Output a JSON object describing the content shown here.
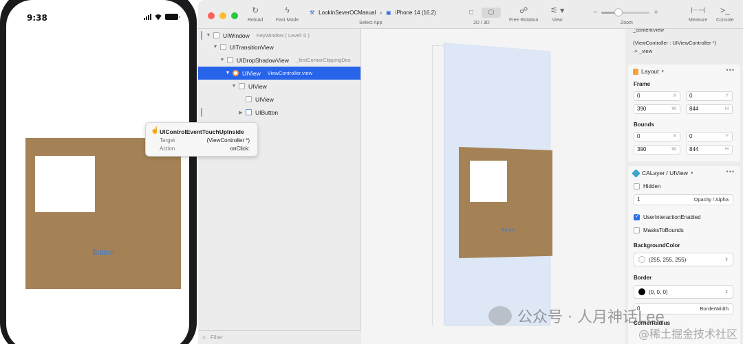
{
  "simulator": {
    "time": "9:38",
    "button_label": "Button"
  },
  "toolbar": {
    "reload": "Reload",
    "fast_mode": "Fast Mode",
    "app_name": "LookInSeverOCManual",
    "device": "iPhone 14 (16.2)",
    "select_app": "Select App",
    "mode_label": "2D / 3D",
    "free_rotation": "Free Rotation",
    "view": "View",
    "zoom": "Zoom",
    "zoom_level": 0.35,
    "measure": "Measure",
    "console": "Console"
  },
  "tree": {
    "rows": [
      {
        "name": "UIWindow",
        "sub": "KeyWindow ( Level: 0 )"
      },
      {
        "name": "UITransitionView",
        "sub": ""
      },
      {
        "name": "UIDropShadowView",
        "sub": "_firstCornerClippingDes"
      },
      {
        "name": "UIView",
        "sub": "ViewController.view"
      },
      {
        "name": "UIView",
        "sub": ""
      },
      {
        "name": "UIView",
        "sub": ""
      },
      {
        "name": "UIButton",
        "sub": ""
      }
    ],
    "filter_placeholder": "Filter"
  },
  "tooltip": {
    "title": "UIControlEventTouchUpInside",
    "target_key": "Target",
    "target_value": "(ViewController *)",
    "action_key": "Action",
    "action_value": "onClick:"
  },
  "canvas": {
    "button_label": "Button"
  },
  "inspector": {
    "top_lines": [
      "_contentView",
      "(ViewController : UIViewController *)",
      "-> _view"
    ],
    "layout_title": "Layout",
    "frame_label": "Frame",
    "frame": {
      "x": "0",
      "y": "0",
      "w": "390",
      "h": "844"
    },
    "bounds_label": "Bounds",
    "bounds": {
      "x": "0",
      "y": "0",
      "w": "390",
      "h": "844"
    },
    "unit_x": "X",
    "unit_y": "Y",
    "unit_w": "W",
    "unit_h": "H",
    "calayer_title": "CALayer / UIView",
    "hidden": "Hidden",
    "opacity_value": "1",
    "opacity_label": "Opacity / Alpha",
    "user_interaction": "UserInteractionEnabled",
    "masks_to_bounds": "MasksToBounds",
    "background_color_label": "BackgroundColor",
    "background_color": "(255, 255, 255)",
    "border_label": "Border",
    "border_color": "(0, 0, 0)",
    "border_width_value": "0",
    "border_width_label": "BorderWidth",
    "corner_radius_label": "CornerRadius"
  },
  "watermark": {
    "main": "公众号 · 人月神话Lee",
    "secondary": "@稀土掘金技术社区"
  },
  "colors": {
    "brown": "#a48256",
    "selection": "#2864ea",
    "button_text": "#3a7ad9"
  }
}
